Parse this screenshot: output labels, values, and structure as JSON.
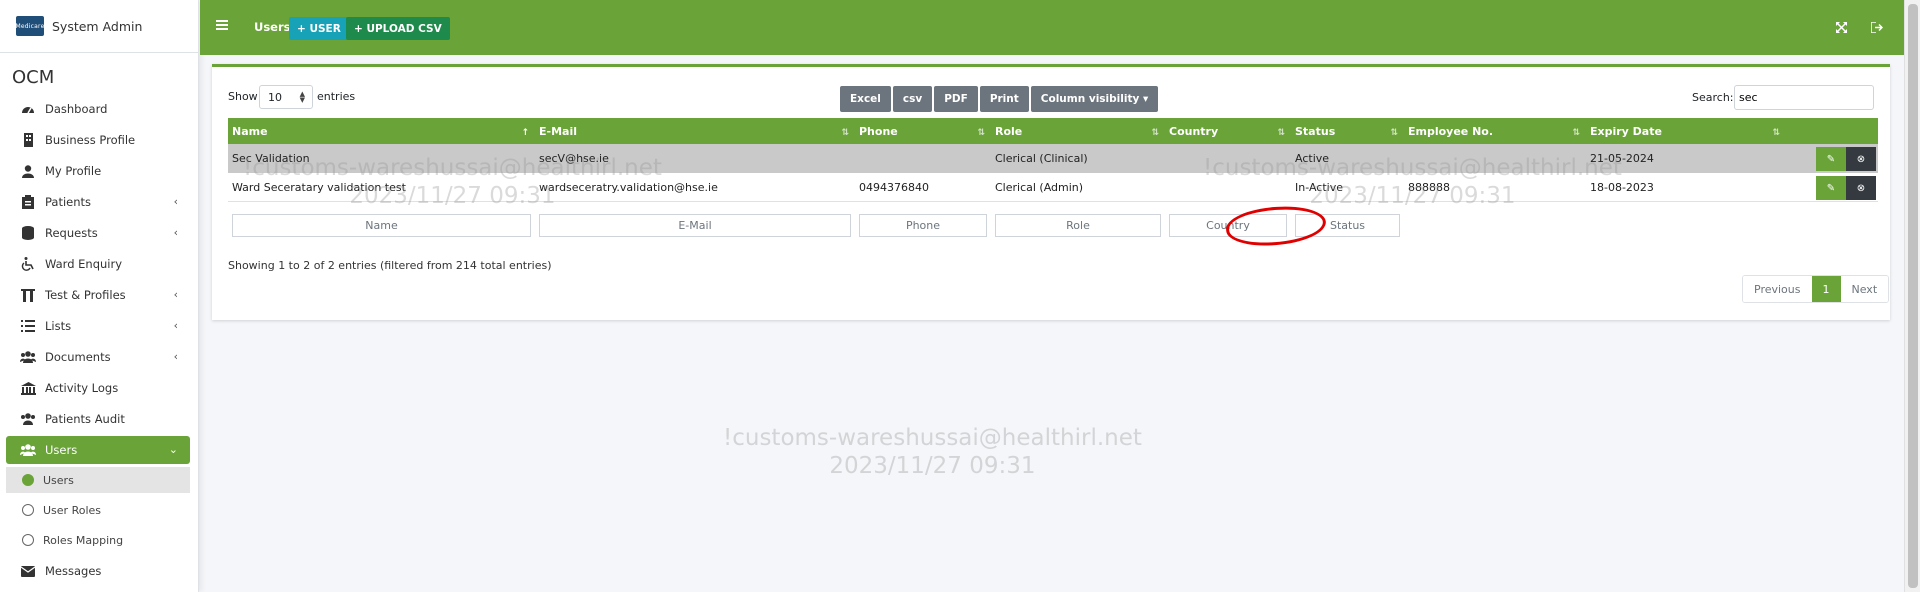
{
  "sidebar": {
    "brand": {
      "logo_text": "Medicare",
      "title": "System Admin"
    },
    "app_name": "OCM",
    "items": [
      {
        "label": "Dashboard",
        "icon": "dashboard-icon"
      },
      {
        "label": "Business Profile",
        "icon": "building-icon"
      },
      {
        "label": "My Profile",
        "icon": "user-icon"
      },
      {
        "label": "Patients",
        "icon": "clipboard-icon"
      },
      {
        "label": "Requests",
        "icon": "database-icon"
      },
      {
        "label": "Ward Enquiry",
        "icon": "wheelchair-icon"
      },
      {
        "label": "Test & Profiles",
        "icon": "flask-icon"
      },
      {
        "label": "Lists",
        "icon": "list-icon"
      },
      {
        "label": "Documents",
        "icon": "users-icon"
      },
      {
        "label": "Activity Logs",
        "icon": "logs-icon"
      },
      {
        "label": "Patients Audit",
        "icon": "audit-icon"
      },
      {
        "label": "Users",
        "icon": "users-icon"
      },
      {
        "label": "Messages",
        "icon": "envelope-icon"
      }
    ],
    "subitems": [
      {
        "label": "Users"
      },
      {
        "label": "User Roles"
      },
      {
        "label": "Roles Mapping"
      }
    ]
  },
  "topbar": {
    "title": "Users",
    "add_user_label": "+ USER",
    "upload_csv_label": "+ UPLOAD CSV"
  },
  "table_controls": {
    "show_label": "Show",
    "page_size": "10",
    "entries_label": "entries",
    "buttons": [
      "Excel",
      "csv",
      "PDF",
      "Print",
      "Column visibility ▾"
    ],
    "search_label": "Search:",
    "search_value": "sec"
  },
  "table": {
    "columns": [
      "Name",
      "E-Mail",
      "Phone",
      "Role",
      "Country",
      "Status",
      "Employee No.",
      "Expiry Date"
    ],
    "rows": [
      {
        "name": "Sec Validation",
        "email": "secV@hse.ie",
        "phone": "",
        "role": "Clerical (Clinical)",
        "country": "",
        "status": "Active",
        "employee_no": "",
        "expiry": "21-05-2024"
      },
      {
        "name": "Ward Seceratary validation test",
        "email": "wardseceratry.validation@hse.ie",
        "phone": "0494376840",
        "role": "Clerical (Admin)",
        "country": "",
        "status": "In-Active",
        "employee_no": "888888",
        "expiry": "18-08-2023"
      }
    ],
    "filters": [
      "Name",
      "E-Mail",
      "Phone",
      "Role",
      "Country",
      "Status"
    ]
  },
  "info_text": "Showing 1 to 2 of 2 entries (filtered from 214 total entries)",
  "pagination": {
    "previous": "Previous",
    "current": "1",
    "next": "Next"
  },
  "watermark": {
    "email": "!customs-wareshussai@healthirl.net",
    "datetime": "2023/11/27 09:31"
  },
  "colors": {
    "primary": "#6aa338",
    "info": "#17a2b8",
    "success": "#1e8a4c",
    "secondary": "#6c757d",
    "dark": "#343a40",
    "annotation": "#e00000"
  }
}
